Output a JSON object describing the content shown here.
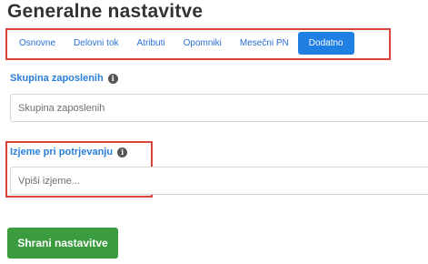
{
  "page": {
    "title": "Generalne nastavitve"
  },
  "tabs": [
    {
      "label": "Osnovne",
      "active": false
    },
    {
      "label": "Delovni tok",
      "active": false
    },
    {
      "label": "Atributi",
      "active": false
    },
    {
      "label": "Opomniki",
      "active": false
    },
    {
      "label": "Mesečni PN",
      "active": false
    },
    {
      "label": "Dodatno",
      "active": true
    }
  ],
  "employee_group": {
    "label": "Skupina zaposlenih",
    "icon": "info-icon",
    "placeholder": "Skupina zaposlenih",
    "value": ""
  },
  "exceptions": {
    "label": "Izjeme pri potrjevanju",
    "icon": "info-icon",
    "placeholder": "Vpiši izjeme...",
    "value": ""
  },
  "actions": {
    "save_label": "Shrani nastavitve"
  },
  "colors": {
    "accent": "#1f7fe3",
    "link": "#2a6fd6",
    "label": "#2a7fd8",
    "save_button": "#3a9b3f",
    "highlight": "#d9453a"
  }
}
